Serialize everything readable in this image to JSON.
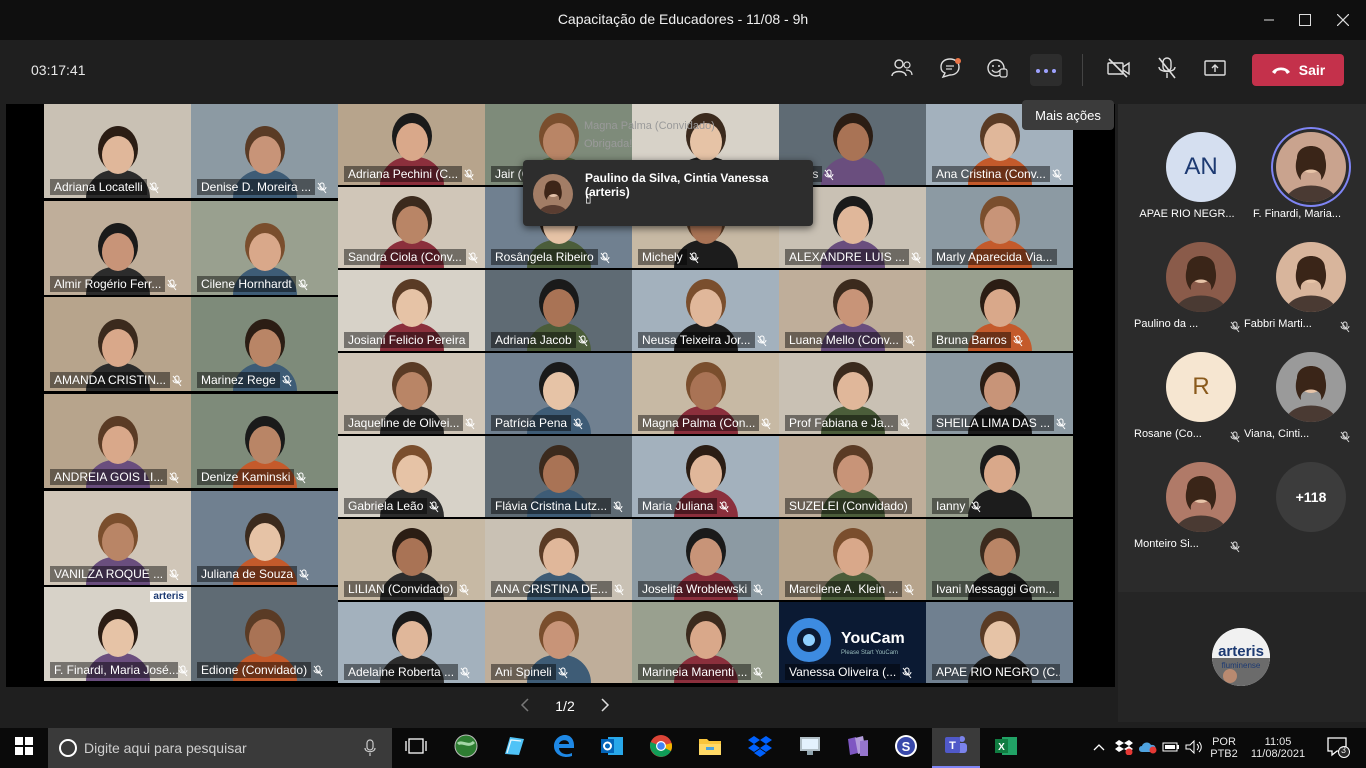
{
  "window": {
    "title": "Capacitação de Educadores - 11/08 - 9h"
  },
  "toolbar": {
    "timer": "03:17:41",
    "leave_label": "Sair",
    "tooltip": "Mais ações"
  },
  "colors": {
    "leave": "#c4314b",
    "accent": "#7f85f5",
    "tooltip": "#3b3b3b"
  },
  "chat_ghost": {
    "sender": "Magna Palma (Convidado)",
    "message": "Obrigada!"
  },
  "hover_card": {
    "names": "Paulino da Silva, Cintia Vanessa (arteris)",
    "indicator": "▯"
  },
  "grid": {
    "tiles": [
      {
        "name": "Adriana Locatelli",
        "muted": true
      },
      {
        "name": "Denise D. Moreira ...",
        "muted": true
      },
      {
        "name": "Adriana Pechini (C...",
        "muted": true
      },
      {
        "name": "Jair (C...",
        "muted": false
      },
      {
        "name": "",
        "muted": false
      },
      {
        "name": "...nos",
        "muted": true
      },
      {
        "name": "Ana Cristina (Conv...",
        "muted": true
      },
      {
        "name": "Almir Rogério Ferr...",
        "muted": true
      },
      {
        "name": "Cilene Hornhardt",
        "muted": true
      },
      {
        "name": "Sandra Ciola (Conv...",
        "muted": true
      },
      {
        "name": "Rosângela Ribeiro",
        "muted": true
      },
      {
        "name": "Michely",
        "muted": true
      },
      {
        "name": "ALEXANDRE LUIS ...",
        "muted": true
      },
      {
        "name": "Marly Aparecida Via...",
        "muted": false
      },
      {
        "name": "AMANDA CRISTIN...",
        "muted": true
      },
      {
        "name": "Marinez Rege",
        "muted": true
      },
      {
        "name": "Josiani Felicio Pereira",
        "muted": false
      },
      {
        "name": "Adriana Jacob",
        "muted": true
      },
      {
        "name": "Neusa Teixeira Jor...",
        "muted": true
      },
      {
        "name": "Luana Mello (Conv...",
        "muted": true
      },
      {
        "name": "Bruna Barros",
        "muted": true
      },
      {
        "name": "Jaqueline de Olivei...",
        "muted": true
      },
      {
        "name": "Patrícia Pena",
        "muted": true
      },
      {
        "name": "Magna Palma (Con...",
        "muted": true
      },
      {
        "name": "Prof Fabiana e Ja...",
        "muted": true
      },
      {
        "name": "SHEILA LIMA DAS ...",
        "muted": true
      },
      {
        "name": "ANDREIA GOIS LI...",
        "muted": true
      },
      {
        "name": "Denize Kaminski",
        "muted": true
      },
      {
        "name": "Gabriela Leão",
        "muted": true
      },
      {
        "name": "Flávia Cristina Lutz...",
        "muted": true
      },
      {
        "name": "Maria Juliana",
        "muted": true
      },
      {
        "name": "SUZELEI (Convidado)",
        "muted": false
      },
      {
        "name": "Ianny",
        "muted": true
      },
      {
        "name": "VANILZA ROQUE ...",
        "muted": true
      },
      {
        "name": "Juliana de Souza",
        "muted": true
      },
      {
        "name": "LILIAN (Convidado)",
        "muted": true
      },
      {
        "name": "ANA CRISTINA DE...",
        "muted": true
      },
      {
        "name": "Joselita Wroblewski",
        "muted": true
      },
      {
        "name": "Marcilene A. Klein ...",
        "muted": true
      },
      {
        "name": "Ivani Messaggi Gom...",
        "muted": false
      },
      {
        "name": "F. Finardi, Maria José...",
        "muted": true
      },
      {
        "name": "Edione (Convidado)",
        "muted": true
      },
      {
        "name": "Adelaine Roberta ...",
        "muted": true
      },
      {
        "name": "Ani Spineli",
        "muted": true
      },
      {
        "name": "Marineia Manenti ...",
        "muted": true
      },
      {
        "name": "Vanessa Oliveira (...",
        "muted": true
      },
      {
        "name": "APAE RIO NEGRO (C...",
        "muted": false
      }
    ],
    "youcam_brand": "YouCam",
    "youcam_sub": "Please Start YouCam",
    "arteris_brand": "arteris"
  },
  "pager": {
    "label": "1/2"
  },
  "panel": {
    "participants": [
      {
        "initials": "AN",
        "name": "APAE RIO NEGR..."
      },
      {
        "initials": "",
        "name": "F. Finardi, Maria..."
      },
      {
        "initials": "",
        "name": "Paulino da ..."
      },
      {
        "initials": "",
        "name": "Fabbri Marti..."
      },
      {
        "initials": "R",
        "name": "Rosane (Co..."
      },
      {
        "initials": "",
        "name": "Viana, Cinti..."
      },
      {
        "initials": "",
        "name": "Monteiro Si..."
      },
      {
        "initials": "+118",
        "name": ""
      }
    ],
    "logo_text": "arteris",
    "logo_sub": "fluminense"
  },
  "taskbar": {
    "search_placeholder": "Digite aqui para pesquisar",
    "lang": "POR",
    "layout": "PTB2",
    "time": "11:05",
    "date": "11/08/2021",
    "notif_count": "3"
  }
}
